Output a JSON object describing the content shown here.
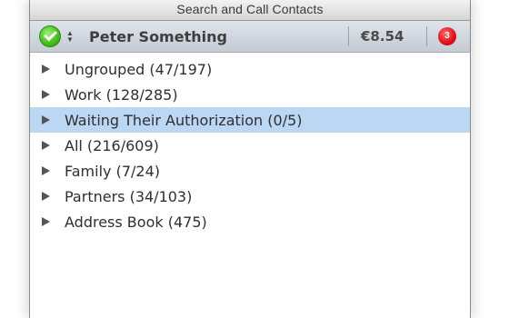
{
  "search": {
    "label": "Search and Call Contacts"
  },
  "account": {
    "status_icon": "online-status-icon",
    "status_color": "#46c21a",
    "stepper_up": "▲",
    "stepper_down": "▼",
    "name": "Peter Something",
    "credit": "€8.54",
    "notifications": "3",
    "notification_color": "#e3121b"
  },
  "groups": [
    {
      "label": "Ungrouped (47/197)"
    },
    {
      "label": "Work (128/285)"
    },
    {
      "label": "Waiting Their Authorization (0/5)",
      "selected": true
    },
    {
      "label": "All (216/609)"
    },
    {
      "label": "Family (7/24)"
    },
    {
      "label": "Partners (34/103)"
    },
    {
      "label": "Address Book (475)"
    }
  ],
  "colors": {
    "selection": "#bcd7f4"
  }
}
